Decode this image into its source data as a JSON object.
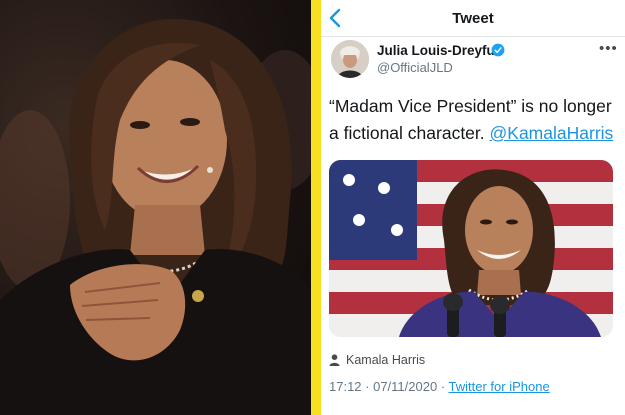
{
  "nav": {
    "title": "Tweet",
    "back_icon": "chevron-left-icon"
  },
  "author": {
    "name": "Julia Louis-Dreyfus",
    "handle": "@OfficialJLD",
    "verified_icon": "verified-badge-icon"
  },
  "tweet": {
    "text": "“Madam Vice President” is no longer a fictional character.",
    "mention": "@KamalaHarris",
    "tagged_person": "Kamala Harris",
    "timestamp": "17:12 · 07/11/2020 · ",
    "source": "Twitter for iPhone"
  },
  "colors": {
    "divider": "#f7e01f",
    "link": "#1b95e0",
    "verified": "#1da1f2",
    "text": "#14171a",
    "secondary": "#657786"
  }
}
